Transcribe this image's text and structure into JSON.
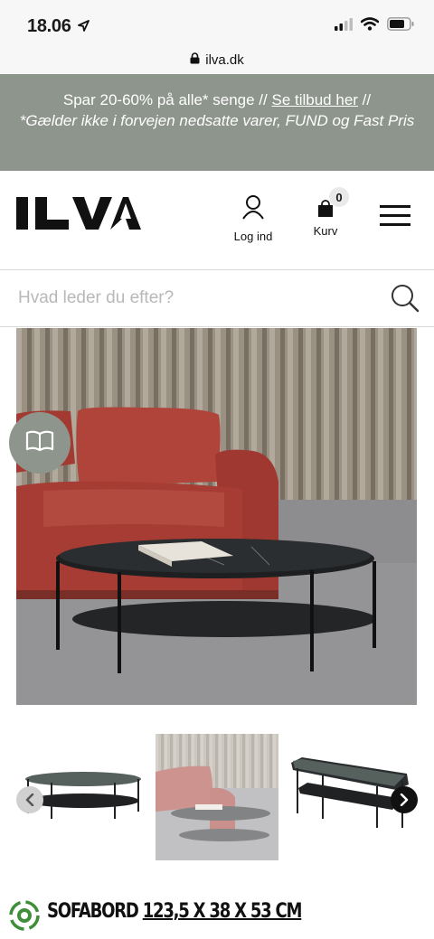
{
  "status": {
    "time": "18.06"
  },
  "browser": {
    "url": "ilva.dk"
  },
  "promo": {
    "line1_prefix": "Spar 20-60% på alle* senge // ",
    "link": "Se tilbud her",
    "line1_suffix": " //",
    "line2": "*Gælder ikke i forvejen nedsatte varer, FUND og Fast Pris"
  },
  "header": {
    "logo": "ILVA",
    "login_label": "Log ind",
    "cart_label": "Kurv",
    "cart_count": "0"
  },
  "search": {
    "placeholder": "Hvad leder du efter?"
  },
  "product": {
    "title_prefix": "SOFABORD ",
    "dimensions": "123,5 X 38 X 53 CM"
  },
  "colors": {
    "promo_bg": "#8e958c",
    "text": "#1a1a1a",
    "eco_green": "#3f8f3a"
  },
  "icons": [
    "location-arrow-icon",
    "signal-icon",
    "wifi-icon",
    "battery-icon",
    "lock-icon",
    "user-icon",
    "shopping-bag-icon",
    "hamburger-menu-icon",
    "search-icon",
    "book-icon",
    "chevron-left-icon",
    "chevron-right-icon",
    "eco-recycle-icon"
  ]
}
